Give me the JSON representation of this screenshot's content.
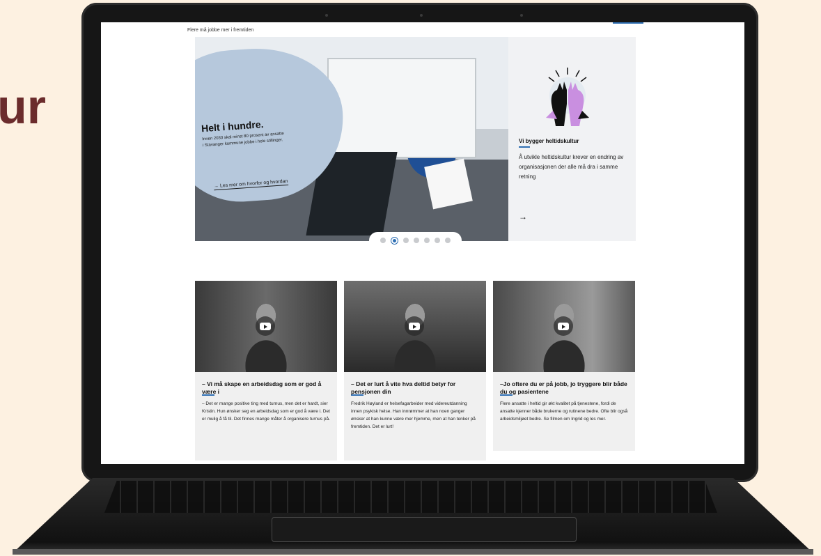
{
  "side_text": "ur",
  "breadcrumb": "Flere må jobbe mer i fremtiden",
  "hero": {
    "title": "Helt i hundre.",
    "description": "Innen 2030 skal minst 80 prosent av ansatte i Stavanger kommune jobbe i hele stillinger.",
    "link": "→ Les mer om hvorfor og hvordan",
    "panel_title": "Vi bygger heltidskultur",
    "panel_text": "Å utvikle heltidskultur krever en endring av organisasjonen der alle må dra i samme retning",
    "panel_arrow": "→"
  },
  "carousel": {
    "count": 7,
    "active_index": 1
  },
  "cards": [
    {
      "title": "– Vi må skape en arbeidsdag som er god å være i",
      "text": "– Det er mange positive ting med turnus, men det er hardt, sier Kristin. Hun ønsker seg en arbeidsdag som er god å være i. Det er mulig å få til. Det finnes mange måter å organisere turnus på.",
      "play_icon": "play-icon"
    },
    {
      "title": "– Det er lurt å vite hva deltid betyr for pensjonen din",
      "text": "Fredrik Høyland er helsefagarbeider med videreutdanning innen psykisk helse. Han innrømmer at han noen ganger ønsker at han kunne være mer hjemme, men at han tenker på fremtiden. Det er lurt!",
      "play_icon": "play-icon"
    },
    {
      "title": "–Jo oftere du er på jobb, jo tryggere blir både du og pasientene",
      "text": "Flere ansatte i heltid gir økt kvalitet på tjenestene, fordi de ansatte kjenner både brukerne og rutinene bedre. Ofte blir også arbeidsmiljøet bedre. Se filmen om Ingrid og les mer.",
      "play_icon": "play-icon"
    }
  ],
  "colors": {
    "background": "#fdf1e1",
    "accent": "#2f6fb3",
    "blob": "#b6c8dc",
    "side_text": "#6b2c2c"
  }
}
